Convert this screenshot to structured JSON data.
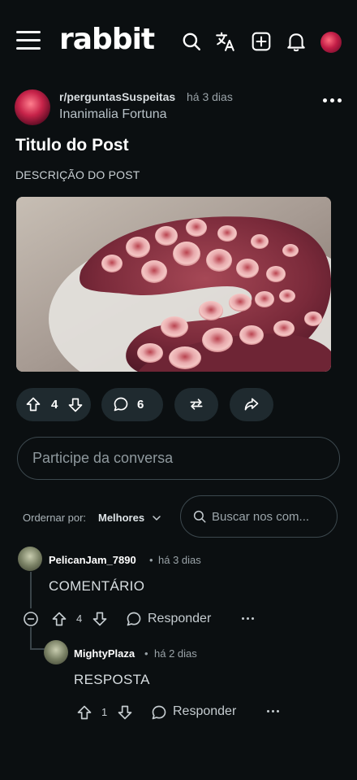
{
  "header": {
    "logo": "rabbit",
    "icons": [
      "menu-icon",
      "search-icon",
      "translate-icon",
      "create-post-icon",
      "bell-icon",
      "avatar"
    ]
  },
  "post": {
    "subreddit": "r/perguntasSuspeitas",
    "time": "há 3 dias",
    "user": "Inanimalia Fortuna",
    "title": "Titulo do Post",
    "description": "DESCRIÇÃO DO POST",
    "votes": "4",
    "comments": "6"
  },
  "join": {
    "placeholder": "Participe da conversa"
  },
  "sort": {
    "label": "Ordernar por:",
    "value": "Melhores",
    "search_placeholder": "Buscar nos com..."
  },
  "comments": [
    {
      "user": "PelicanJam_7890",
      "time": "há 3 dias",
      "body": "COMENTÁRIO",
      "votes": "4",
      "reply_label": "Responder"
    },
    {
      "user": "MightyPlaza",
      "time": "há 2 dias",
      "body": "RESPOSTA",
      "votes": "1",
      "reply_label": "Responder"
    }
  ],
  "colors": {
    "background": "#0b0f11",
    "pill": "#1f2a2f",
    "border": "#3c484e"
  }
}
